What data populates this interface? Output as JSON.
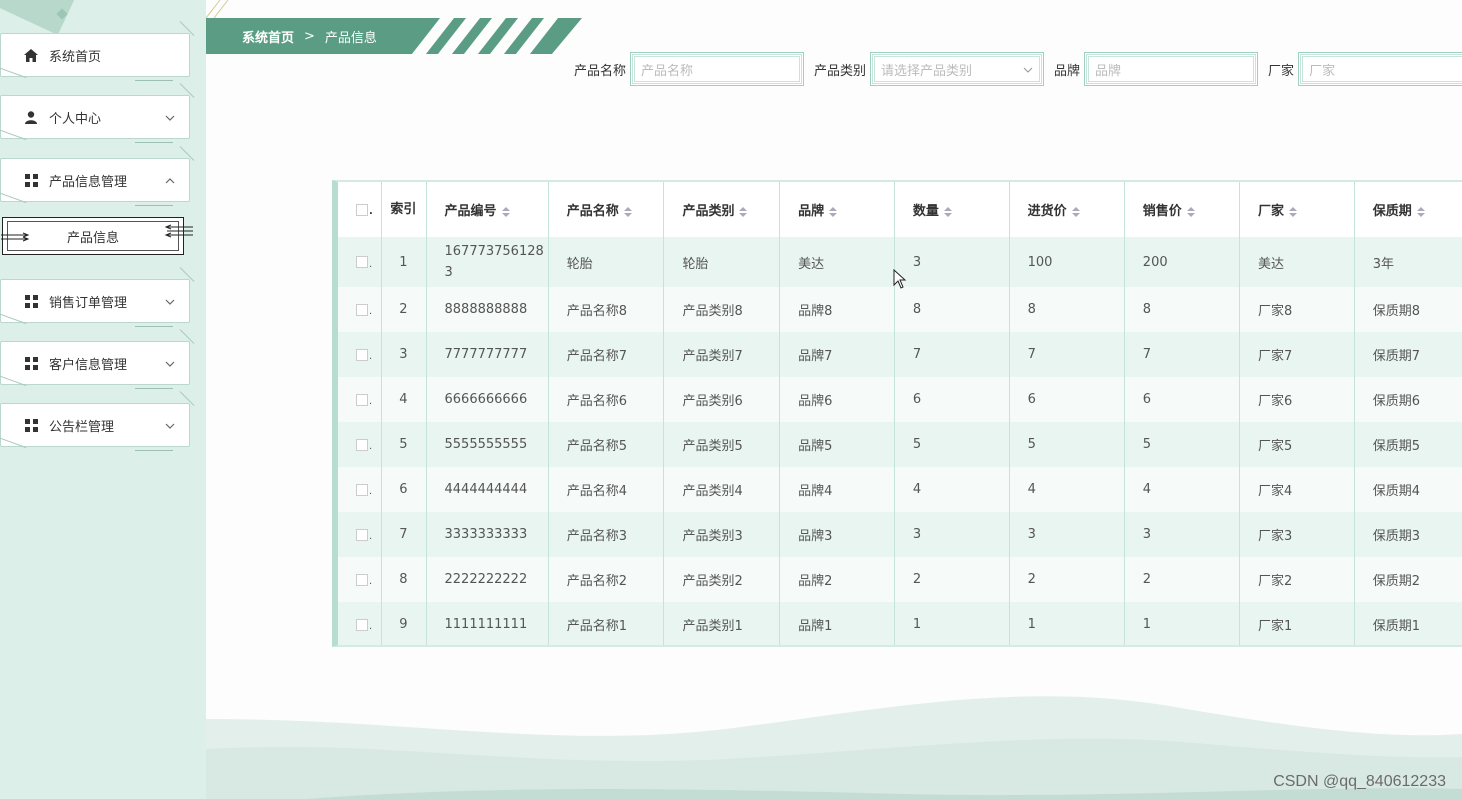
{
  "sidebar": {
    "items": [
      {
        "label": "系统首页",
        "icon": "home-icon"
      },
      {
        "label": "个人中心",
        "icon": "user-icon",
        "chevron": "down"
      },
      {
        "label": "产品信息管理",
        "icon": "grid-icon",
        "chevron": "up"
      },
      {
        "label": "销售订单管理",
        "icon": "grid-icon",
        "chevron": "down"
      },
      {
        "label": "客户信息管理",
        "icon": "grid-icon",
        "chevron": "down"
      },
      {
        "label": "公告栏管理",
        "icon": "grid-icon",
        "chevron": "down"
      }
    ],
    "active_sub": "产品信息"
  },
  "breadcrumb": {
    "home": "系统首页",
    "separator": ">",
    "current": "产品信息"
  },
  "filters": {
    "name_label": "产品名称",
    "name_placeholder": "产品名称",
    "category_label": "产品类别",
    "category_placeholder": "请选择产品类别",
    "brand_label": "品牌",
    "brand_placeholder": "品牌",
    "maker_label": "厂家",
    "maker_placeholder": "厂家"
  },
  "table": {
    "headers": {
      "index": "索引",
      "code": "产品编号",
      "name": "产品名称",
      "category": "产品类别",
      "brand": "品牌",
      "qty": "数量",
      "cost": "进货价",
      "price": "销售价",
      "maker": "厂家",
      "shelf": "保质期"
    },
    "rows": [
      [
        "1",
        "1677737561283",
        "轮胎",
        "轮胎",
        "美达",
        "3",
        "100",
        "200",
        "美达",
        "3年"
      ],
      [
        "2",
        "8888888888",
        "产品名称8",
        "产品类别8",
        "品牌8",
        "8",
        "8",
        "8",
        "厂家8",
        "保质期8"
      ],
      [
        "3",
        "7777777777",
        "产品名称7",
        "产品类别7",
        "品牌7",
        "7",
        "7",
        "7",
        "厂家7",
        "保质期7"
      ],
      [
        "4",
        "6666666666",
        "产品名称6",
        "产品类别6",
        "品牌6",
        "6",
        "6",
        "6",
        "厂家6",
        "保质期6"
      ],
      [
        "5",
        "5555555555",
        "产品名称5",
        "产品类别5",
        "品牌5",
        "5",
        "5",
        "5",
        "厂家5",
        "保质期5"
      ],
      [
        "6",
        "4444444444",
        "产品名称4",
        "产品类别4",
        "品牌4",
        "4",
        "4",
        "4",
        "厂家4",
        "保质期4"
      ],
      [
        "7",
        "3333333333",
        "产品名称3",
        "产品类别3",
        "品牌3",
        "3",
        "3",
        "3",
        "厂家3",
        "保质期3"
      ],
      [
        "8",
        "2222222222",
        "产品名称2",
        "产品类别2",
        "品牌2",
        "2",
        "2",
        "2",
        "厂家2",
        "保质期2"
      ],
      [
        "9",
        "1111111111",
        "产品名称1",
        "产品类别1",
        "品牌1",
        "1",
        "1",
        "1",
        "厂家1",
        "保质期1"
      ]
    ]
  },
  "watermark": "CSDN @qq_840612233",
  "colors": {
    "accent": "#5a9d84",
    "sidebar_bg": "#dcefe8",
    "row_odd": "#e9f5f0",
    "row_even": "#f6fbf9"
  }
}
